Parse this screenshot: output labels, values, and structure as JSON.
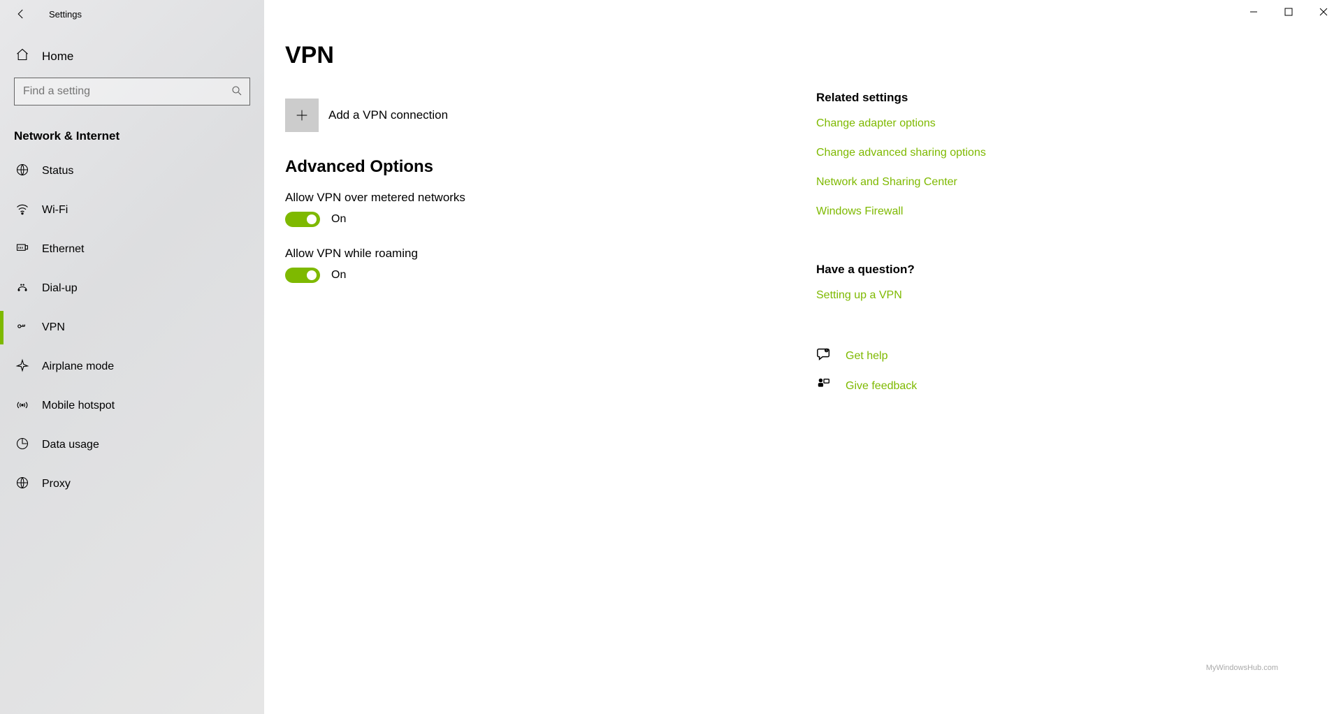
{
  "app": {
    "title": "Settings"
  },
  "sidebar": {
    "home": "Home",
    "search_placeholder": "Find a setting",
    "category": "Network & Internet",
    "items": [
      {
        "label": "Status",
        "icon": "globe"
      },
      {
        "label": "Wi-Fi",
        "icon": "wifi"
      },
      {
        "label": "Ethernet",
        "icon": "ethernet"
      },
      {
        "label": "Dial-up",
        "icon": "dialup"
      },
      {
        "label": "VPN",
        "icon": "vpn",
        "active": true
      },
      {
        "label": "Airplane mode",
        "icon": "airplane"
      },
      {
        "label": "Mobile hotspot",
        "icon": "hotspot"
      },
      {
        "label": "Data usage",
        "icon": "usage"
      },
      {
        "label": "Proxy",
        "icon": "proxy"
      }
    ]
  },
  "page": {
    "title": "VPN",
    "add_label": "Add a VPN connection",
    "advanced_heading": "Advanced Options",
    "options": [
      {
        "label": "Allow VPN over metered networks",
        "state": "On"
      },
      {
        "label": "Allow VPN while roaming",
        "state": "On"
      }
    ]
  },
  "related": {
    "heading": "Related settings",
    "links": [
      "Change adapter options",
      "Change advanced sharing options",
      "Network and Sharing Center",
      "Windows Firewall"
    ]
  },
  "question": {
    "heading": "Have a question?",
    "links": [
      "Setting up a VPN"
    ]
  },
  "actions": {
    "help": "Get help",
    "feedback": "Give feedback"
  },
  "watermark": "MyWindowsHub.com"
}
